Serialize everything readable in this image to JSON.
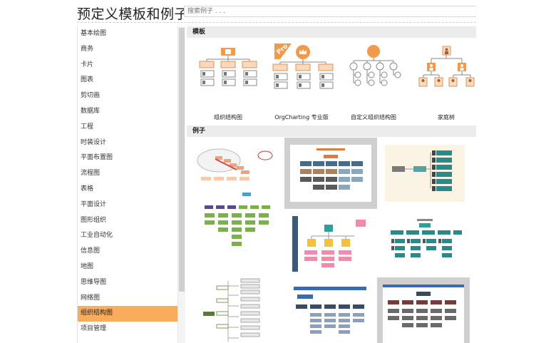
{
  "header": {
    "title": "预定义模板和例子",
    "search_placeholder": "搜索例子 . . ."
  },
  "sidebar": {
    "items": [
      {
        "label": "基本绘图"
      },
      {
        "label": "商务"
      },
      {
        "label": "卡片"
      },
      {
        "label": "图表"
      },
      {
        "label": "剪切画"
      },
      {
        "label": "数据库"
      },
      {
        "label": "工程"
      },
      {
        "label": "时装设计"
      },
      {
        "label": "平面布置图"
      },
      {
        "label": "流程图"
      },
      {
        "label": "表格"
      },
      {
        "label": "平面设计"
      },
      {
        "label": "图形组织"
      },
      {
        "label": "工业自动化"
      },
      {
        "label": "信息图"
      },
      {
        "label": "地图"
      },
      {
        "label": "思维导图"
      },
      {
        "label": "网络图"
      },
      {
        "label": "组织结构图",
        "selected": true
      },
      {
        "label": "项目管理"
      }
    ]
  },
  "templates": {
    "heading": "模板",
    "items": [
      {
        "label": "组织结构图",
        "icon": "org-chart-icon"
      },
      {
        "label": "OrgCharting 专业版",
        "icon": "orgcharting-pro-icon",
        "badge": "Pro"
      },
      {
        "label": "自定义组织结构图",
        "icon": "custom-org-chart-icon"
      },
      {
        "label": "家庭树",
        "icon": "family-tree-icon"
      }
    ]
  },
  "examples": {
    "heading": "例子",
    "colors": {
      "accent": "#f9ac5b",
      "selected_frame": "#cfcfcf"
    }
  }
}
